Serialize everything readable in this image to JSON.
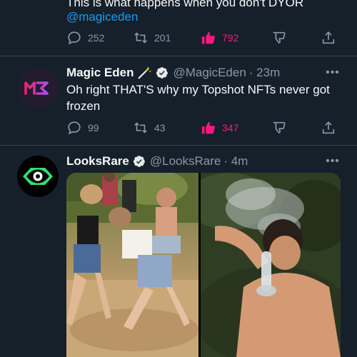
{
  "prev_tweet": {
    "text": "This is what happens when you don't DYOR",
    "mention": "@magiceden",
    "actions": {
      "reply_count": "252",
      "retweet_count": "201",
      "like_count": "792"
    }
  },
  "tweet_magiceden": {
    "name": "Magic Eden",
    "handle": "@MagicEden",
    "time": "· 23m",
    "text": "Oh right THAT'S why my Topshot NFTs never got frozen",
    "actions": {
      "reply_count": "99",
      "retweet_count": "43",
      "like_count": "347"
    }
  },
  "tweet_looksrare": {
    "name": "LooksRare",
    "handle": "@LooksRare",
    "time": "· 4m"
  },
  "colors": {
    "background": "#15202b",
    "accent": "#1d9bf0",
    "like": "#f91880",
    "muted": "#8b98a5"
  },
  "icons": [
    "reply-icon",
    "retweet-icon",
    "like-icon",
    "dislike-icon",
    "share-icon",
    "verified-icon",
    "wand-icon",
    "more-icon"
  ]
}
